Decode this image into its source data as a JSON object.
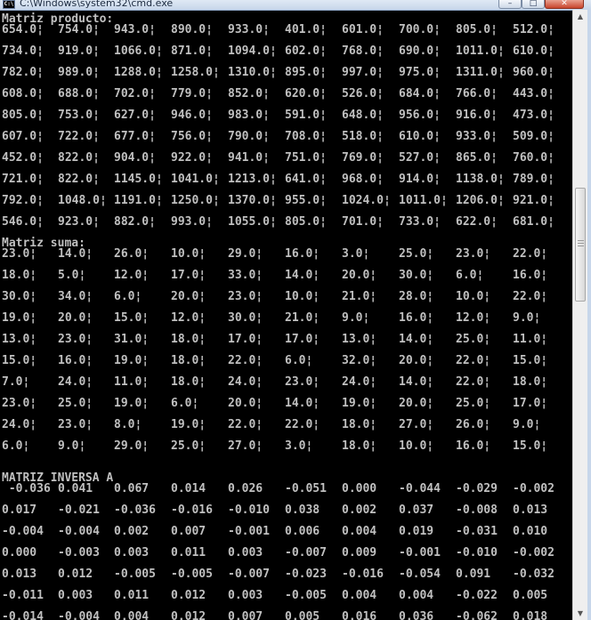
{
  "window": {
    "title": "C:\\Windows\\system32\\cmd.exe",
    "icon_text": "C:\\",
    "minimize": "–",
    "maximize": "□",
    "close": "✕"
  },
  "console": {
    "sections": [
      {
        "heading": "Matriz producto:",
        "rows": [
          [
            "654.0¦",
            "754.0¦",
            "943.0¦",
            "890.0¦",
            "933.0¦",
            "401.0¦",
            "601.0¦",
            "700.0¦",
            "805.0¦",
            "512.0¦"
          ],
          [
            "734.0¦",
            "919.0¦",
            "1066.0¦",
            "871.0¦",
            "1094.0¦",
            "602.0¦",
            "768.0¦",
            "690.0¦",
            "1011.0¦",
            "610.0¦"
          ],
          [
            "782.0¦",
            "989.0¦",
            "1288.0¦",
            "1258.0¦",
            "1310.0¦",
            "895.0¦",
            "997.0¦",
            "975.0¦",
            "1311.0¦",
            "960.0¦"
          ],
          [
            "608.0¦",
            "688.0¦",
            "702.0¦",
            "779.0¦",
            "852.0¦",
            "620.0¦",
            "526.0¦",
            "684.0¦",
            "766.0¦",
            "443.0¦"
          ],
          [
            "805.0¦",
            "753.0¦",
            "627.0¦",
            "946.0¦",
            "983.0¦",
            "591.0¦",
            "648.0¦",
            "956.0¦",
            "916.0¦",
            "473.0¦"
          ],
          [
            "607.0¦",
            "722.0¦",
            "677.0¦",
            "756.0¦",
            "790.0¦",
            "708.0¦",
            "518.0¦",
            "610.0¦",
            "933.0¦",
            "509.0¦"
          ],
          [
            "452.0¦",
            "822.0¦",
            "904.0¦",
            "922.0¦",
            "941.0¦",
            "751.0¦",
            "769.0¦",
            "527.0¦",
            "865.0¦",
            "760.0¦"
          ],
          [
            "721.0¦",
            "822.0¦",
            "1145.0¦",
            "1041.0¦",
            "1213.0¦",
            "641.0¦",
            "968.0¦",
            "914.0¦",
            "1138.0¦",
            "789.0¦"
          ],
          [
            "792.0¦",
            "1048.0¦",
            "1191.0¦",
            "1250.0¦",
            "1370.0¦",
            "955.0¦",
            "1024.0¦",
            "1011.0¦",
            "1206.0¦",
            "921.0¦"
          ],
          [
            "546.0¦",
            "923.0¦",
            "882.0¦",
            "993.0¦",
            "1055.0¦",
            "805.0¦",
            "701.0¦",
            "733.0¦",
            "622.0¦",
            "681.0¦"
          ]
        ]
      },
      {
        "heading": "Matriz suma:",
        "rows": [
          [
            "23.0¦",
            "14.0¦",
            "26.0¦",
            "10.0¦",
            "29.0¦",
            "16.0¦",
            "3.0¦",
            "25.0¦",
            "23.0¦",
            "22.0¦"
          ],
          [
            "18.0¦",
            "5.0¦",
            "12.0¦",
            "17.0¦",
            "33.0¦",
            "14.0¦",
            "20.0¦",
            "30.0¦",
            "6.0¦",
            "16.0¦"
          ],
          [
            "30.0¦",
            "34.0¦",
            "6.0¦",
            "20.0¦",
            "23.0¦",
            "10.0¦",
            "21.0¦",
            "28.0¦",
            "10.0¦",
            "22.0¦"
          ],
          [
            "19.0¦",
            "20.0¦",
            "15.0¦",
            "12.0¦",
            "30.0¦",
            "21.0¦",
            "9.0¦",
            "16.0¦",
            "12.0¦",
            "9.0¦"
          ],
          [
            "13.0¦",
            "23.0¦",
            "31.0¦",
            "18.0¦",
            "17.0¦",
            "17.0¦",
            "13.0¦",
            "14.0¦",
            "25.0¦",
            "11.0¦"
          ],
          [
            "15.0¦",
            "16.0¦",
            "19.0¦",
            "18.0¦",
            "22.0¦",
            "6.0¦",
            "32.0¦",
            "20.0¦",
            "22.0¦",
            "15.0¦"
          ],
          [
            "7.0¦",
            "24.0¦",
            "11.0¦",
            "18.0¦",
            "24.0¦",
            "23.0¦",
            "24.0¦",
            "14.0¦",
            "22.0¦",
            "18.0¦"
          ],
          [
            "23.0¦",
            "25.0¦",
            "19.0¦",
            "6.0¦",
            "20.0¦",
            "14.0¦",
            "19.0¦",
            "20.0¦",
            "25.0¦",
            "17.0¦"
          ],
          [
            "24.0¦",
            "23.0¦",
            "8.0¦",
            "19.0¦",
            "22.0¦",
            "22.0¦",
            "18.0¦",
            "27.0¦",
            "26.0¦",
            "9.0¦"
          ],
          [
            "6.0¦",
            "9.0¦",
            "29.0¦",
            "25.0¦",
            "27.0¦",
            "3.0¦",
            "18.0¦",
            "10.0¦",
            "16.0¦",
            "15.0¦"
          ]
        ]
      },
      {
        "heading": "MATRIZ INVERSA A",
        "rows": [
          [
            " -0.036",
            "0.041",
            "0.067",
            "0.014",
            "0.026",
            "-0.051",
            "0.000",
            "-0.044",
            "-0.029",
            "-0.002"
          ],
          [
            "0.017",
            "-0.021",
            "-0.036",
            "-0.016",
            "-0.010",
            "0.038",
            "0.002",
            "0.037",
            "-0.008",
            "0.013"
          ],
          [
            "-0.004",
            "-0.004",
            "0.002",
            "0.007",
            "-0.001",
            "0.006",
            "0.004",
            "0.019",
            "-0.031",
            "0.010"
          ],
          [
            "0.000",
            "-0.003",
            "0.003",
            "0.011",
            "0.003",
            "-0.007",
            "0.009",
            "-0.001",
            "-0.010",
            "-0.002"
          ],
          [
            "0.013",
            "0.012",
            "-0.005",
            "-0.005",
            "-0.007",
            "-0.023",
            "-0.016",
            "-0.054",
            "0.091",
            "-0.032"
          ],
          [
            "-0.011",
            "0.003",
            "0.011",
            "0.012",
            "0.003",
            "-0.005",
            "0.004",
            "0.004",
            "-0.022",
            "0.005"
          ],
          [
            "-0.014",
            "-0.004",
            "0.004",
            "0.012",
            "0.007",
            "0.005",
            "0.016",
            "0.036",
            "-0.062",
            "0.018"
          ]
        ]
      }
    ]
  },
  "scrollbar": {
    "up": "▲",
    "down": "▼"
  }
}
